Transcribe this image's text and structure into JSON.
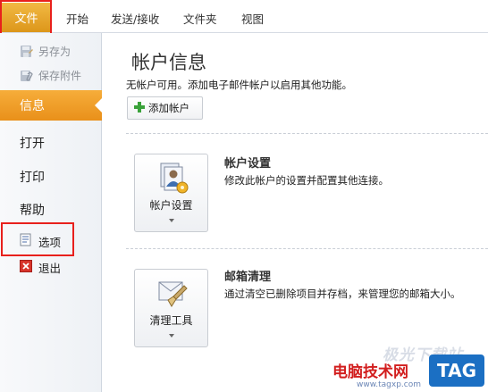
{
  "ribbon": {
    "file_tab": "文件",
    "tabs": [
      "开始",
      "发送/接收",
      "文件夹",
      "视图"
    ]
  },
  "sidebar": {
    "save_as": "另存为",
    "save_attachments": "保存附件",
    "info": "信息",
    "open": "打开",
    "print": "打印",
    "help": "帮助",
    "options": "选项",
    "exit": "退出"
  },
  "main": {
    "title": "帐户信息",
    "subtitle": "无帐户可用。添加电子邮件帐户以启用其他功能。",
    "add_account": "添加帐户",
    "account_settings": {
      "button_label": "帐户设置",
      "title": "帐户设置",
      "description": "修改此帐户的设置并配置其他连接。"
    },
    "mailbox_cleanup": {
      "button_label": "清理工具",
      "title": "邮箱清理",
      "description": "通过清空已删除项目并存档，来管理您的邮箱大小。"
    }
  },
  "watermark": {
    "top": "极光下载站",
    "middle": "电脑技术网",
    "url": "www.tagxp.com",
    "tag": "TAG"
  },
  "colors": {
    "accent": "#f0a530",
    "highlight_box": "#e8201c"
  }
}
